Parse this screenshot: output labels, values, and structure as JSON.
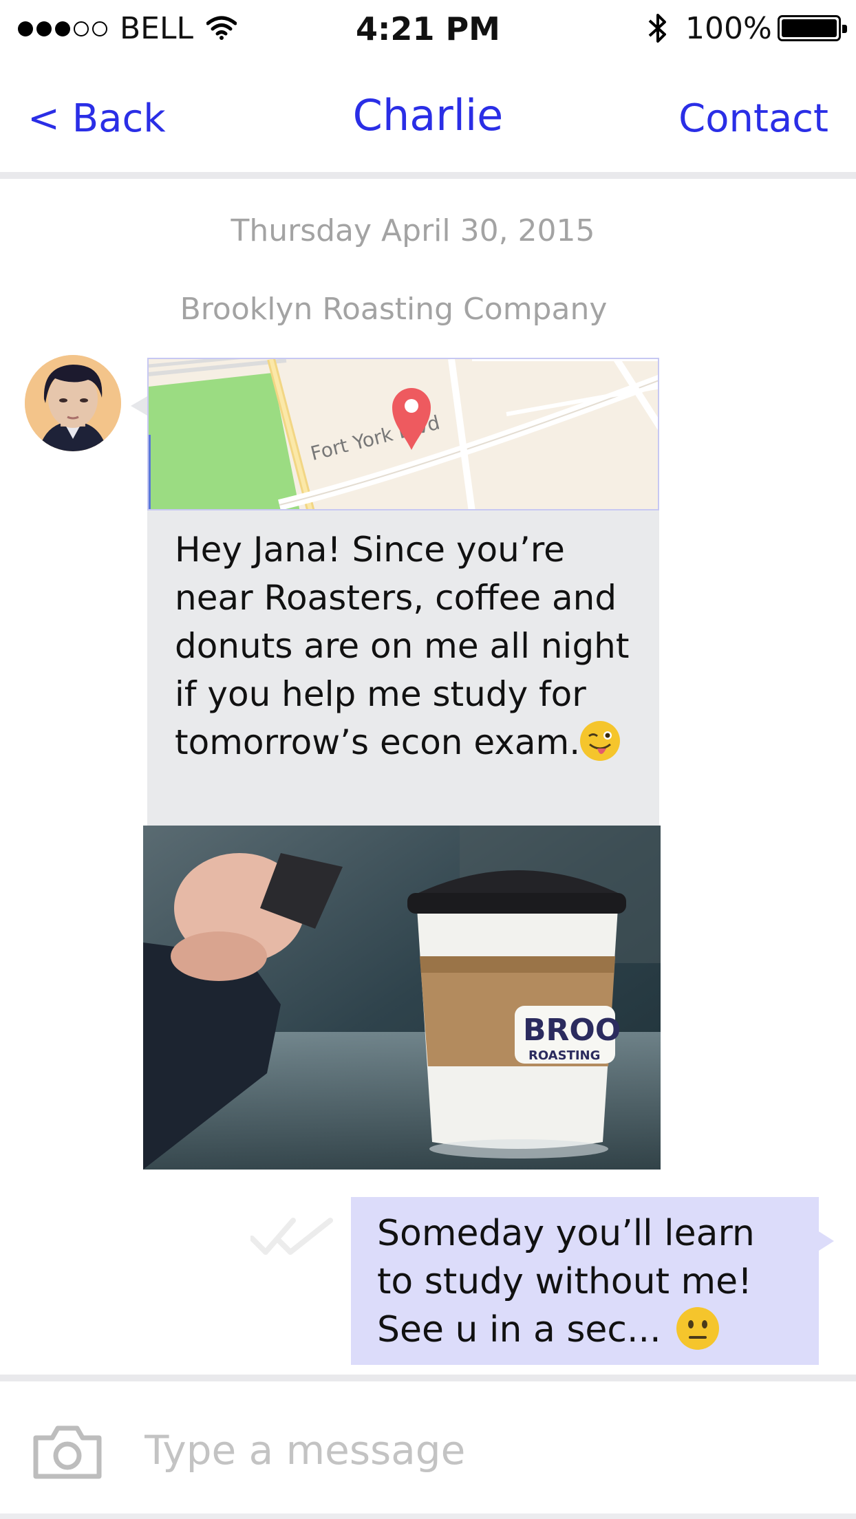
{
  "status_bar": {
    "carrier": "BELL",
    "time": "4:21 PM",
    "battery": "100%",
    "signal_bars_filled": 3,
    "signal_bars_total": 5,
    "icons": [
      "wifi-icon",
      "bluetooth-icon",
      "battery-icon"
    ]
  },
  "nav": {
    "back_label": "< Back",
    "title": "Charlie",
    "contact_label": "Contact"
  },
  "conversation": {
    "date": "Thursday April 30, 2015",
    "location": "Brooklyn Roasting Company",
    "map": {
      "street_label": "Fort York Blvd",
      "pin_color": "#ee5a5f"
    },
    "received_message": "Hey Jana! Since you’re near Roasters, coffee and donuts are on me all night if you help me study for tomorrow’s econ exam.",
    "received_emoji": "winking-tongue-emoji",
    "photo": {
      "cup_brand": "BROO",
      "cup_brand_sub": "ROASTING"
    },
    "sent_message_line1": "Someday you’ll learn",
    "sent_message_line2": "to study without me!",
    "sent_message_line3": "See u in a sec...",
    "sent_emoji": "neutral-face-emoji",
    "read_receipt": "double-check-icon"
  },
  "composer": {
    "placeholder": "Type a message",
    "camera_icon": "camera-icon"
  },
  "colors": {
    "accent": "#2a2ee6",
    "received_bubble": "#e9eaec",
    "sent_bubble": "#dcdcfa",
    "muted_text": "#a3a3a3"
  }
}
